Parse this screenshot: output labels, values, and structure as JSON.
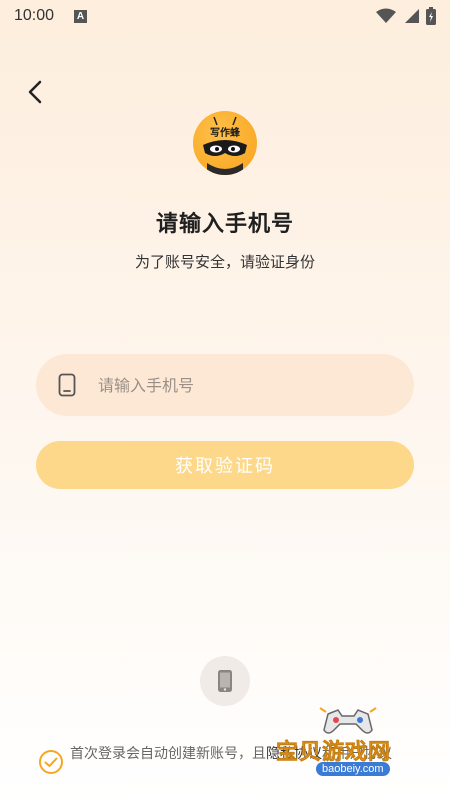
{
  "status_bar": {
    "time": "10:00",
    "notification_letter": "A"
  },
  "header": {
    "back_icon": "chevron-left-icon"
  },
  "logo": {
    "text": "写作蜂",
    "icon": "bee-logo-icon",
    "brand_color": "#f7a21b"
  },
  "title": "请输入手机号",
  "subtitle": "为了账号安全，请验证身份",
  "phone_input": {
    "placeholder": "请输入手机号",
    "value": "",
    "icon": "phone-icon"
  },
  "get_code_button": {
    "label": "获取验证码",
    "color": "#fdd88a"
  },
  "onekey_login": {
    "icon": "mobile-phone-icon"
  },
  "agreement": {
    "checked": true,
    "text": "首次登录会自动创建新账号，且",
    "link_fragment": "隐私协议",
    "text_tail": "和用户协议"
  },
  "watermark": {
    "title": "宝贝游戏网",
    "url": "baobeiy.com"
  },
  "colors": {
    "accent": "#f5a623",
    "input_bg": "#fde8d6",
    "button_bg": "#fdd88a"
  }
}
